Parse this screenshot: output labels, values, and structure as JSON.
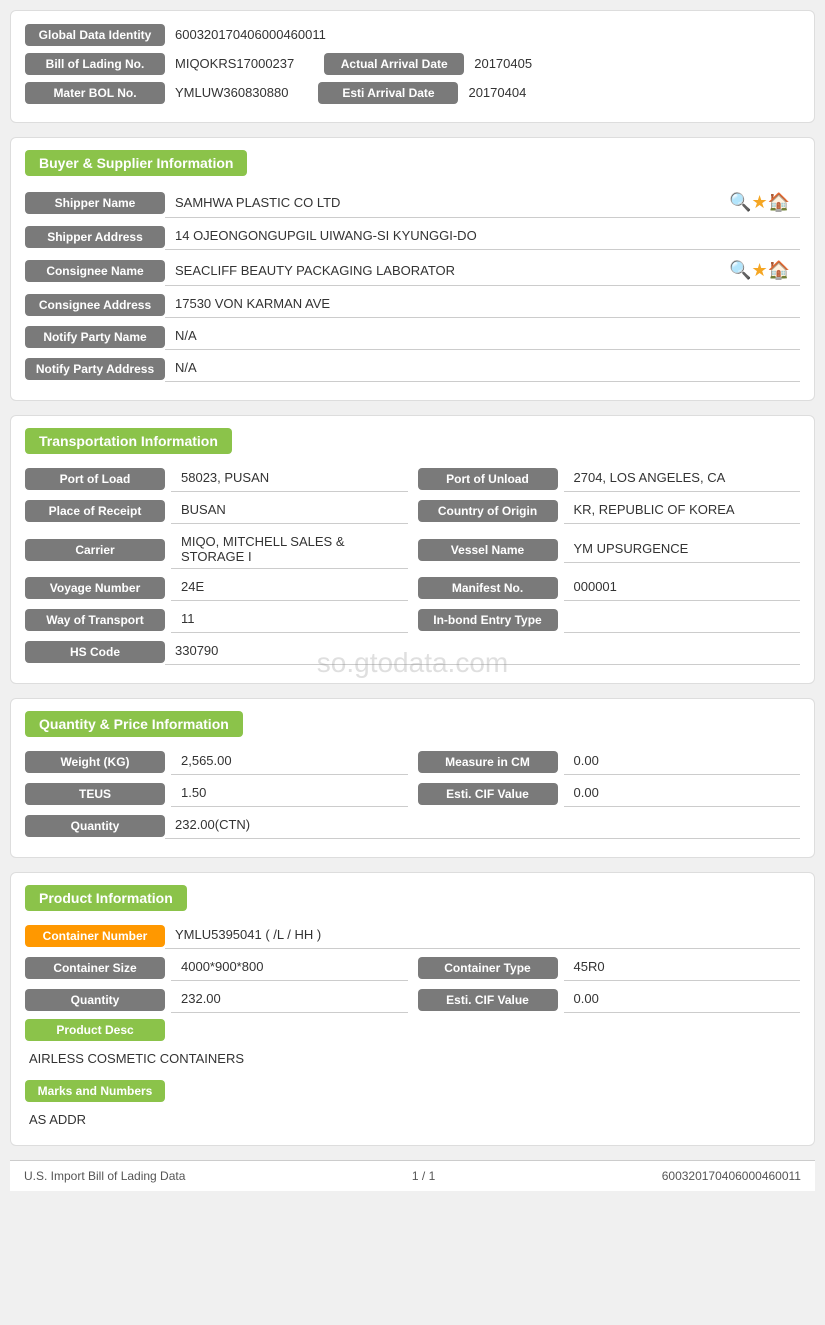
{
  "top": {
    "global_data_identity_label": "Global Data Identity",
    "global_data_identity_value": "600320170406000460011",
    "bill_of_lading_label": "Bill of Lading No.",
    "bill_of_lading_value": "MIQOKRS17000237",
    "actual_arrival_date_label": "Actual Arrival Date",
    "actual_arrival_date_value": "20170405",
    "mater_bol_label": "Mater BOL No.",
    "mater_bol_value": "YMLUW360830880",
    "esti_arrival_date_label": "Esti Arrival Date",
    "esti_arrival_date_value": "20170404"
  },
  "buyer_supplier": {
    "section_title": "Buyer & Supplier Information",
    "shipper_name_label": "Shipper Name",
    "shipper_name_value": "SAMHWA PLASTIC CO LTD",
    "shipper_address_label": "Shipper Address",
    "shipper_address_value": "14 OJEONGONGUPGIL UIWANG-SI KYUNGGI-DO",
    "consignee_name_label": "Consignee Name",
    "consignee_name_value": "SEACLIFF BEAUTY PACKAGING LABORATOR",
    "consignee_address_label": "Consignee Address",
    "consignee_address_value": "17530 VON KARMAN AVE",
    "notify_party_name_label": "Notify Party Name",
    "notify_party_name_value": "N/A",
    "notify_party_address_label": "Notify Party Address",
    "notify_party_address_value": "N/A"
  },
  "transportation": {
    "section_title": "Transportation Information",
    "port_of_load_label": "Port of Load",
    "port_of_load_value": "58023, PUSAN",
    "port_of_unload_label": "Port of Unload",
    "port_of_unload_value": "2704, LOS ANGELES, CA",
    "place_of_receipt_label": "Place of Receipt",
    "place_of_receipt_value": "BUSAN",
    "country_of_origin_label": "Country of Origin",
    "country_of_origin_value": "KR, REPUBLIC OF KOREA",
    "carrier_label": "Carrier",
    "carrier_value": "MIQO, MITCHELL SALES & STORAGE I",
    "vessel_name_label": "Vessel Name",
    "vessel_name_value": "YM UPSURGENCE",
    "voyage_number_label": "Voyage Number",
    "voyage_number_value": "24E",
    "manifest_no_label": "Manifest No.",
    "manifest_no_value": "000001",
    "way_of_transport_label": "Way of Transport",
    "way_of_transport_value": "11",
    "in_bond_entry_type_label": "In-bond Entry Type",
    "in_bond_entry_type_value": "",
    "hs_code_label": "HS Code",
    "hs_code_value": "330790"
  },
  "quantity_price": {
    "section_title": "Quantity & Price Information",
    "weight_kg_label": "Weight (KG)",
    "weight_kg_value": "2,565.00",
    "measure_in_cm_label": "Measure in CM",
    "measure_in_cm_value": "0.00",
    "teus_label": "TEUS",
    "teus_value": "1.50",
    "esti_cif_value_label": "Esti. CIF Value",
    "esti_cif_value_value": "0.00",
    "quantity_label": "Quantity",
    "quantity_value": "232.00(CTN)"
  },
  "product": {
    "section_title": "Product Information",
    "container_number_label": "Container Number",
    "container_number_value": "YMLU5395041 ( /L / HH )",
    "container_size_label": "Container Size",
    "container_size_value": "4000*900*800",
    "container_type_label": "Container Type",
    "container_type_value": "45R0",
    "quantity_label": "Quantity",
    "quantity_value": "232.00",
    "esti_cif_value_label": "Esti. CIF Value",
    "esti_cif_value_value": "0.00",
    "product_desc_label": "Product Desc",
    "product_desc_value": "AIRLESS COSMETIC CONTAINERS",
    "marks_and_numbers_label": "Marks and Numbers",
    "marks_and_numbers_value": "AS ADDR"
  },
  "footer": {
    "left": "U.S. Import Bill of Lading Data",
    "center": "1 / 1",
    "right": "600320170406000460011"
  },
  "watermark": "so.gtodata.com"
}
